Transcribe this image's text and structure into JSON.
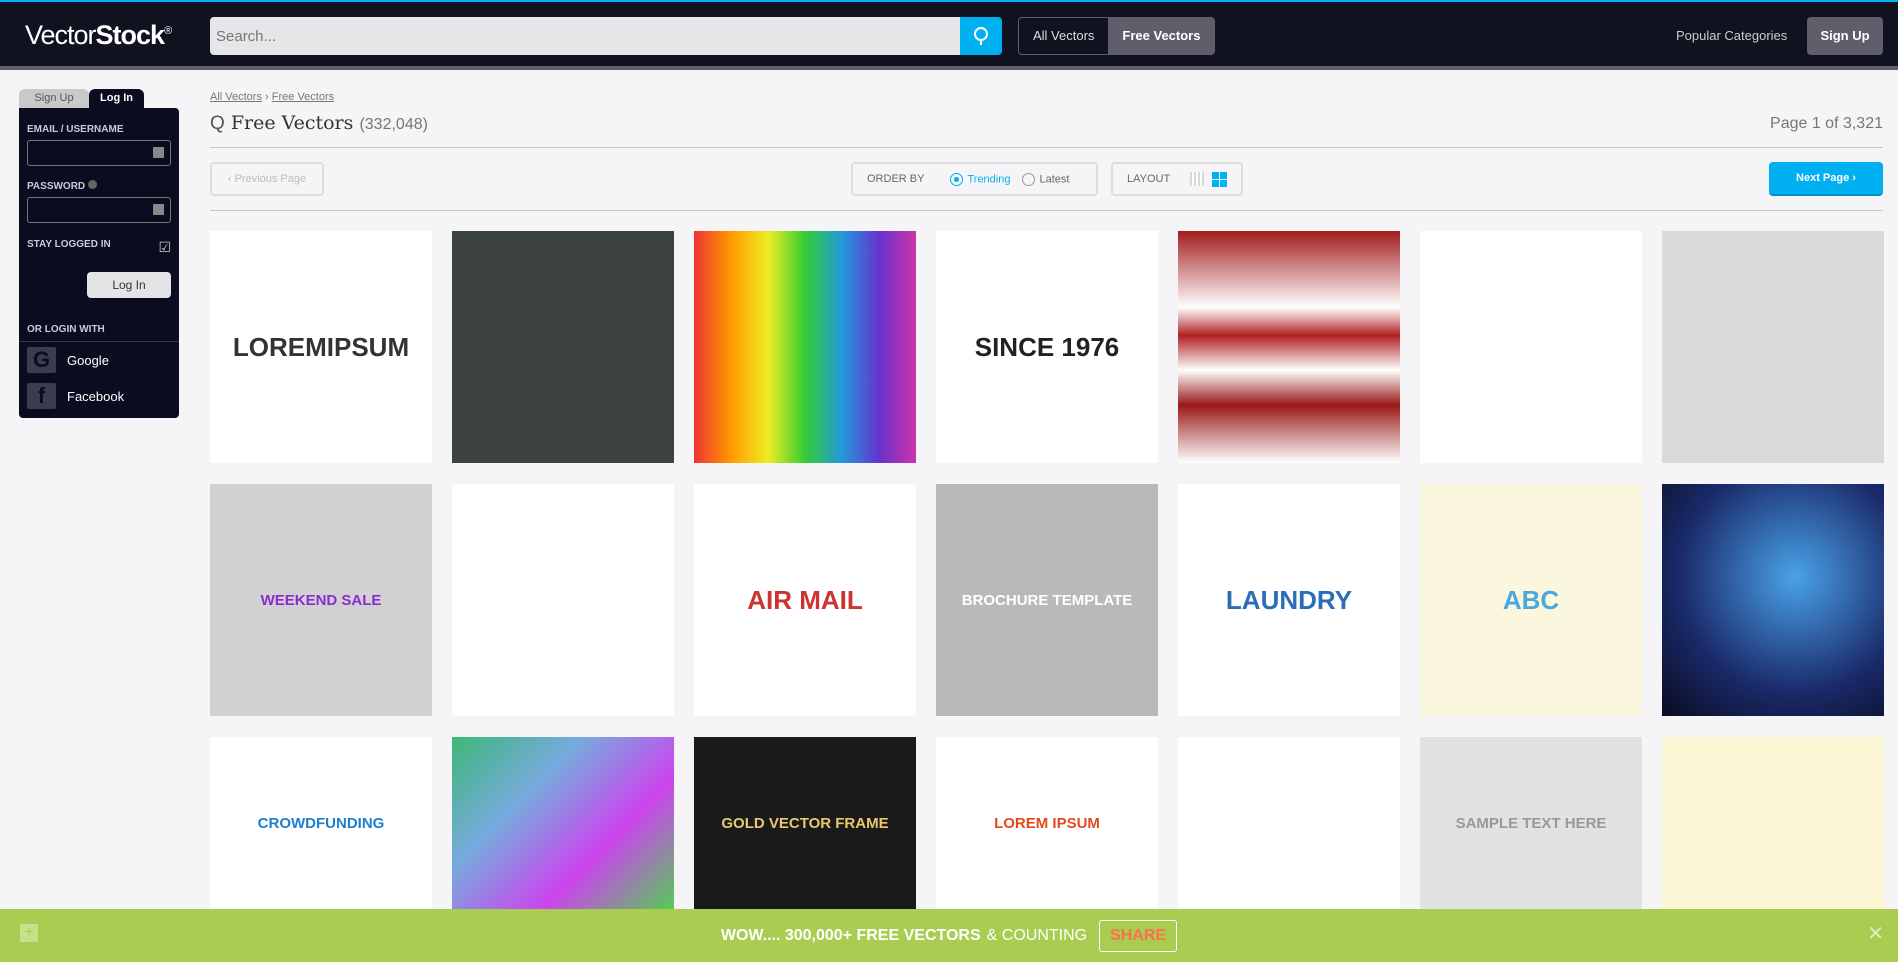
{
  "header": {
    "logo_light": "Vector",
    "logo_bold": "Stock",
    "logo_mark": "®",
    "search_placeholder": "Search...",
    "toggle": [
      "All Vectors",
      "Free Vectors"
    ],
    "popular": "Popular Categories",
    "signup": "Sign Up",
    "accent": "#00b0f0"
  },
  "sidebar": {
    "tabs": [
      "Sign Up",
      "Log In"
    ],
    "email_label": "EMAIL / USERNAME",
    "password_label": "PASSWORD",
    "stay": "STAY LOGGED IN",
    "stay_checked": true,
    "login": "Log In",
    "or": "OR LOGIN WITH",
    "google": "Google",
    "facebook": "Facebook"
  },
  "main": {
    "breadcrumb": [
      "All Vectors",
      "Free Vectors"
    ],
    "breadcrumb_sep": "›",
    "title": "Free Vectors",
    "count": "(332,048)",
    "page": "Page 1 of 3,321",
    "prev": "‹  Previous Page",
    "order_by": "ORDER BY",
    "trending": "Trending",
    "latest": "Latest",
    "layout": "LAYOUT",
    "next": "Next Page  ›"
  },
  "tiles": [
    {
      "bg": "#ffffff",
      "fg": "#333",
      "text": "LOREMIPSUM"
    },
    {
      "bg": "#3c4241",
      "fg": "#ddd",
      "text": ""
    },
    {
      "bg": "linear-gradient(90deg,#e33,#f90,#ee2,#3c3,#29d,#63c,#c3a)",
      "fg": "#fff",
      "text": ""
    },
    {
      "bg": "#ffffff",
      "fg": "#222",
      "text": "SINCE 1976"
    },
    {
      "bg": "linear-gradient(180deg,#a21d1d,#fff 33%,#b02020 45%,#fff 60%,#9a1818 75%,#fff)",
      "fg": "#fff",
      "text": ""
    },
    {
      "bg": "#ffffff",
      "fg": "#e3c",
      "text": ""
    },
    {
      "bg": "#d8dadc",
      "fg": "#333",
      "text": ""
    },
    {
      "bg": "#d1d1d3",
      "fg": "#8a2bd2",
      "text": "WEEKEND SALE"
    },
    {
      "bg": "#ffffff",
      "fg": "#333",
      "text": ""
    },
    {
      "bg": "#ffffff",
      "fg": "#c33",
      "text": "AIR MAIL"
    },
    {
      "bg": "#b8b9bb",
      "fg": "#fff",
      "text": "BROCHURE TEMPLATE"
    },
    {
      "bg": "#ffffff",
      "fg": "#2a6fb5",
      "text": "LAUNDRY"
    },
    {
      "bg": "#fbf7df",
      "fg": "#4aa8dc",
      "text": "ABC"
    },
    {
      "bg": "radial-gradient(circle at 60% 40%,#4aa2e8,#1a2a6a 60%,#0a0c20)",
      "fg": "#fff",
      "text": ""
    },
    {
      "bg": "#ffffff",
      "fg": "#1b7fd0",
      "text": "CROWDFUNDING"
    },
    {
      "bg": "linear-gradient(135deg,#3cb878,#7ad,#c4e,#5c5)",
      "fg": "#fff",
      "text": ""
    },
    {
      "bg": "#1a1a1a",
      "fg": "#e8c870",
      "text": "GOLD VECTOR FRAME"
    },
    {
      "bg": "#ffffff",
      "fg": "#e24a1a",
      "text": "LOREM IPSUM"
    },
    {
      "bg": "#ffffff",
      "fg": "#e33",
      "text": ""
    },
    {
      "bg": "#e2e2e2",
      "fg": "#999",
      "text": "SAMPLE TEXT HERE"
    },
    {
      "bg": "#fbf6d4",
      "fg": "#5a3",
      "text": ""
    }
  ],
  "banner": {
    "text": "WOW.... 300,000+ FREE VECTORS",
    "text2": "& COUNTING",
    "share": "SHARE",
    "bg": "#a8cd50"
  }
}
